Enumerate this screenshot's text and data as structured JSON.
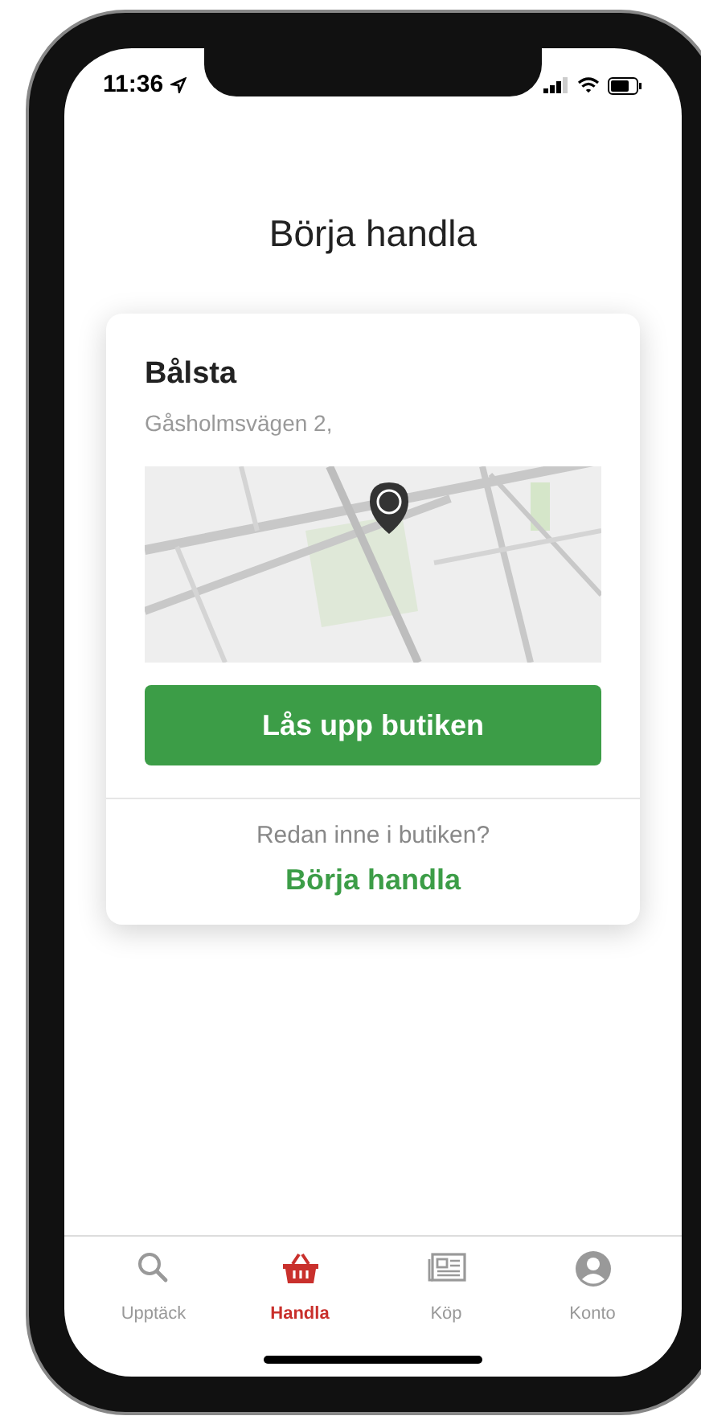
{
  "status_bar": {
    "time": "11:36"
  },
  "title": "Börja handla",
  "store": {
    "name": "Bålsta",
    "address": "Gåsholmsvägen 2,",
    "unlock_button": "Lås upp butiken",
    "prompt": "Redan inne i butiken?",
    "start_link": "Börja handla"
  },
  "tabs": [
    {
      "label": "Upptäck",
      "kind": "search",
      "selected": false
    },
    {
      "label": "Handla",
      "kind": "basket",
      "selected": true
    },
    {
      "label": "Köp",
      "kind": "receipt",
      "selected": false
    },
    {
      "label": "Konto",
      "kind": "account",
      "selected": false
    }
  ]
}
